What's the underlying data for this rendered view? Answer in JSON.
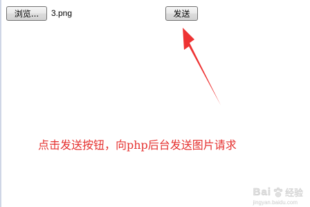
{
  "form": {
    "browse_label": "浏览...",
    "file_name": "3.png",
    "send_label": "发送"
  },
  "annotation": {
    "text": "点击发送按钮，向php后台发送图片请求",
    "color": "#e5312f"
  },
  "watermark": {
    "brand": "Bai",
    "brand_suffix": "经验",
    "url": "jingyan.baidu.com"
  }
}
